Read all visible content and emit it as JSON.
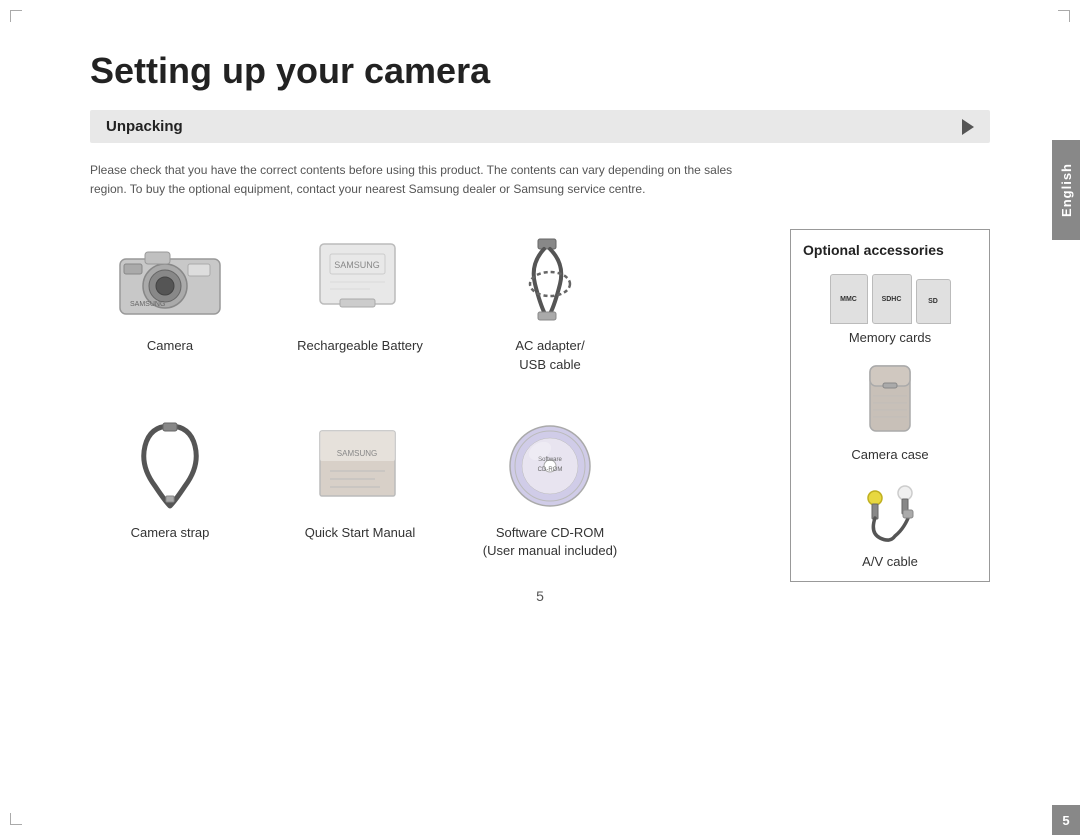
{
  "page": {
    "title": "Setting up your camera",
    "section_header": "Unpacking",
    "description": "Please check that you have the correct contents before using this product. The contents can vary depending on the sales region.\nTo buy the optional equipment, contact your nearest Samsung dealer or Samsung service centre.",
    "language_tab": "English",
    "page_number": "5"
  },
  "items": [
    {
      "id": "camera",
      "label": "Camera"
    },
    {
      "id": "battery",
      "label": "Rechargeable Battery"
    },
    {
      "id": "ac_adapter",
      "label": "AC adapter/\nUSB cable"
    },
    {
      "id": "strap",
      "label": "Camera strap"
    },
    {
      "id": "manual",
      "label": "Quick Start Manual"
    },
    {
      "id": "cdrom",
      "label": "Software CD-ROM\n(User manual included)"
    }
  ],
  "optional": {
    "title": "Optional accessories",
    "items": [
      {
        "id": "memory_cards",
        "label": "Memory cards",
        "cards": [
          "MMC",
          "SDHC",
          "SD"
        ]
      },
      {
        "id": "camera_case",
        "label": "Camera case"
      },
      {
        "id": "av_cable",
        "label": "A/V cable"
      }
    ]
  }
}
